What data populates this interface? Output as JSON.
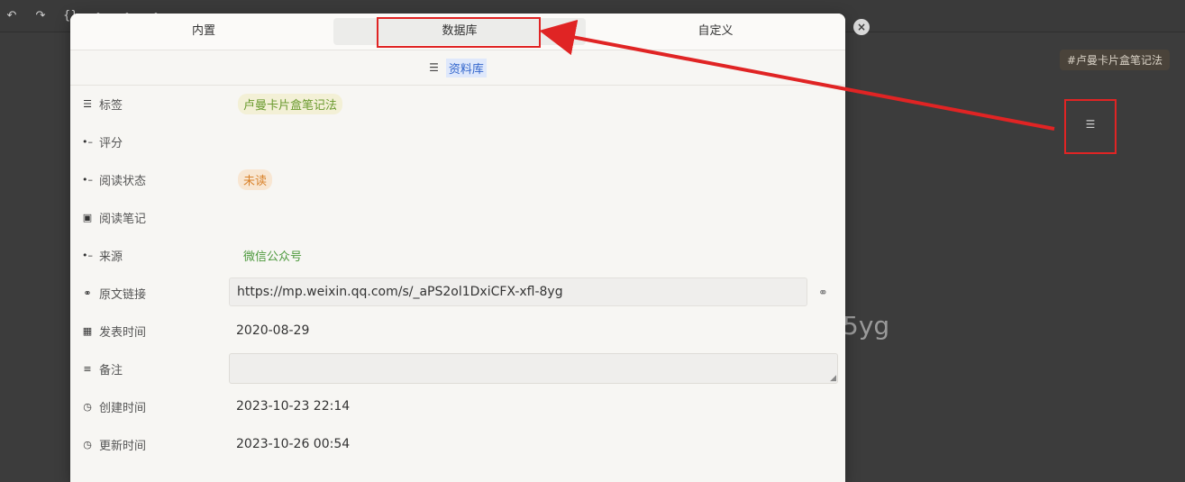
{
  "background": {
    "tag_text": "#卢曼卡片盒笔记法",
    "partial_text": "5yg",
    "database_icon": "database-icon",
    "close_icon": "close-icon"
  },
  "dialog": {
    "tabs": [
      {
        "label": "内置"
      },
      {
        "label": "数据库"
      },
      {
        "label": "自定义"
      }
    ],
    "database_name": "资料库",
    "fields": [
      {
        "icon": "list-icon",
        "label": "标签",
        "value": "卢曼卡片盒笔记法"
      },
      {
        "icon": "select-icon",
        "label": "评分",
        "value": ""
      },
      {
        "icon": "select-icon",
        "label": "阅读状态",
        "value": "未读"
      },
      {
        "icon": "image-icon",
        "label": "阅读笔记",
        "value": ""
      },
      {
        "icon": "select-icon",
        "label": "来源",
        "value": "微信公众号"
      },
      {
        "icon": "link-icon",
        "label": "原文链接",
        "value": "https://mp.weixin.qq.com/s/_aPS2ol1DxiCFX-xfl-8yg"
      },
      {
        "icon": "calendar-icon",
        "label": "发表时间",
        "value": "2020-08-29"
      },
      {
        "icon": "text-icon",
        "label": "备注",
        "value": ""
      },
      {
        "icon": "clock-icon",
        "label": "创建时间",
        "value": "2023-10-23 22:14"
      },
      {
        "icon": "clock-icon",
        "label": "更新时间",
        "value": "2023-10-26 00:54"
      }
    ]
  },
  "colors": {
    "annotation": "#e02424",
    "tag_chip_text": "#6a9a2e",
    "status_chip_text": "#d9822b",
    "source_text": "#4e9a3e"
  }
}
